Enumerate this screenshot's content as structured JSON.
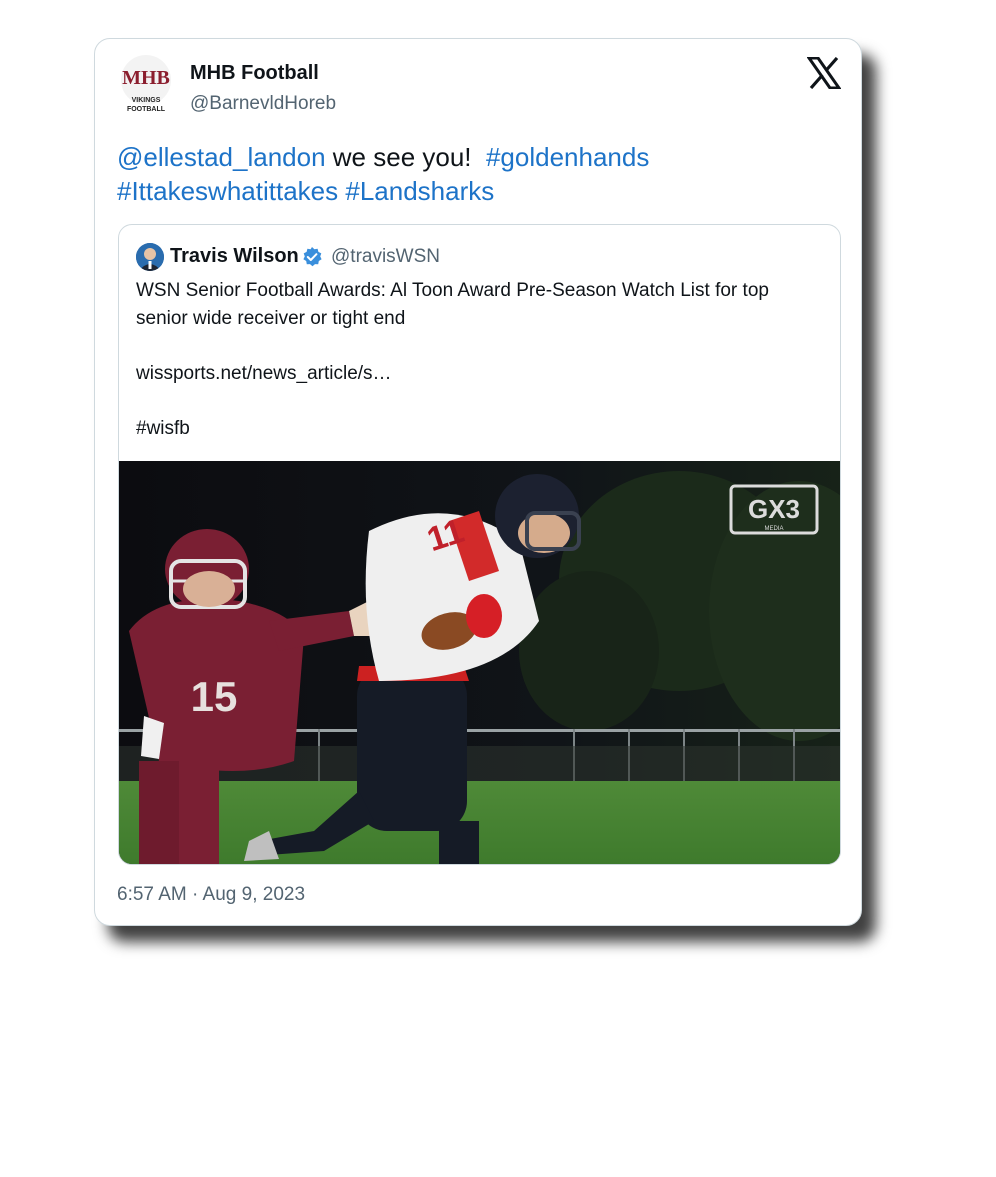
{
  "tweet": {
    "author_name": "MHB Football",
    "author_handle": "@BarnevldHoreb",
    "avatar_text_top": "MHB",
    "avatar_text_line1": "VIKINGS",
    "avatar_text_line2": "FOOTBALL",
    "text_mention": "@ellestad_landon",
    "text_plain": " we see you!  ",
    "text_hashtag1": "#goldenhands",
    "text_hashtag2": "#Ittakeswhatittakes",
    "text_hashtag3": "#Landsharks",
    "timestamp": "6:57 AM · Aug 9, 2023"
  },
  "quoted": {
    "author_name": "Travis Wilson",
    "author_handle": "@travisWSN",
    "line1": "WSN Senior Football Awards: Al Toon Award Pre-Season Watch List for top senior wide receiver or tight end",
    "link": "wissports.net/news_article/s…",
    "hashtag": "#wisfb",
    "photo_watermark": "GX3",
    "photo_watermark_sub": "MEDIA",
    "jersey_left": "15",
    "jersey_right": "11"
  },
  "colors": {
    "link": "#1d73c8",
    "text": "#0f1419",
    "muted": "#536471",
    "maroon": "#7a1f33",
    "verified": "#3a8fdc"
  },
  "icons": {
    "platform": "x-logo-icon",
    "verified": "verified-badge-icon"
  }
}
